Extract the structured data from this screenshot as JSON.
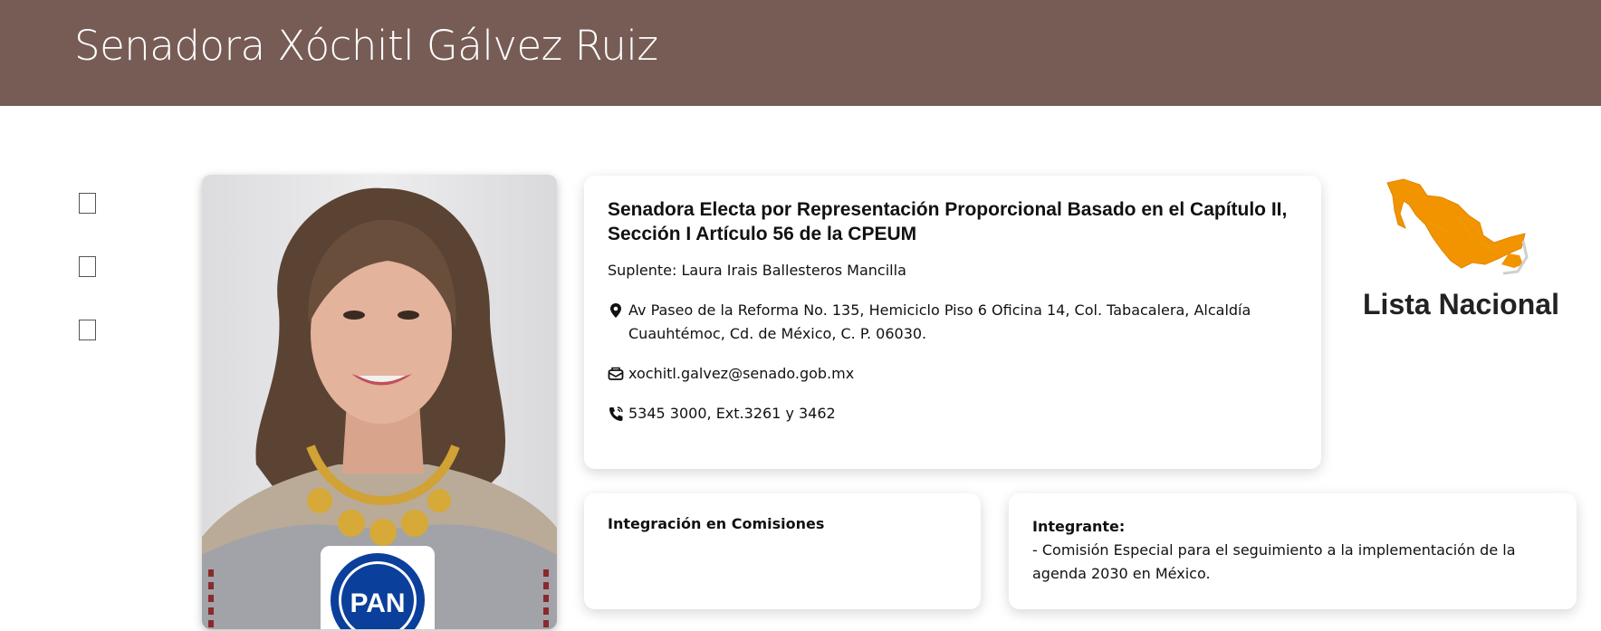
{
  "header": {
    "title": "Senadora Xóchitl Gálvez Ruiz"
  },
  "social": {
    "icons": [
      "facebook-icon",
      "twitter-icon",
      "instagram-icon"
    ]
  },
  "profile": {
    "party_logo_text": "PAN",
    "heading": "Senadora Electa por Representación Proporcional Basado en el Capítulo II, Sección I Artículo 56 de la CPEUM",
    "suplente": "Suplente: Laura Irais Ballesteros Mancilla",
    "address": "Av Paseo de la Reforma No. 135, Hemiciclo Piso 6 Oficina 14, Col. Tabacalera, Alcaldía Cuauhtémoc, Cd. de México, C. P. 06030.",
    "email": "xochitl.galvez@senado.gob.mx",
    "phone": "5345 3000, Ext.3261 y 3462"
  },
  "lista": {
    "label": "Lista Nacional",
    "map_color": "#f29400"
  },
  "comisiones": {
    "title": "Integración en Comisiones",
    "role": "Integrante:",
    "item": "- Comisión Especial para el seguimiento a la implementación de la agenda 2030 en México."
  },
  "colors": {
    "header_bg": "#775c56",
    "party_blue": "#0a3f9c"
  }
}
